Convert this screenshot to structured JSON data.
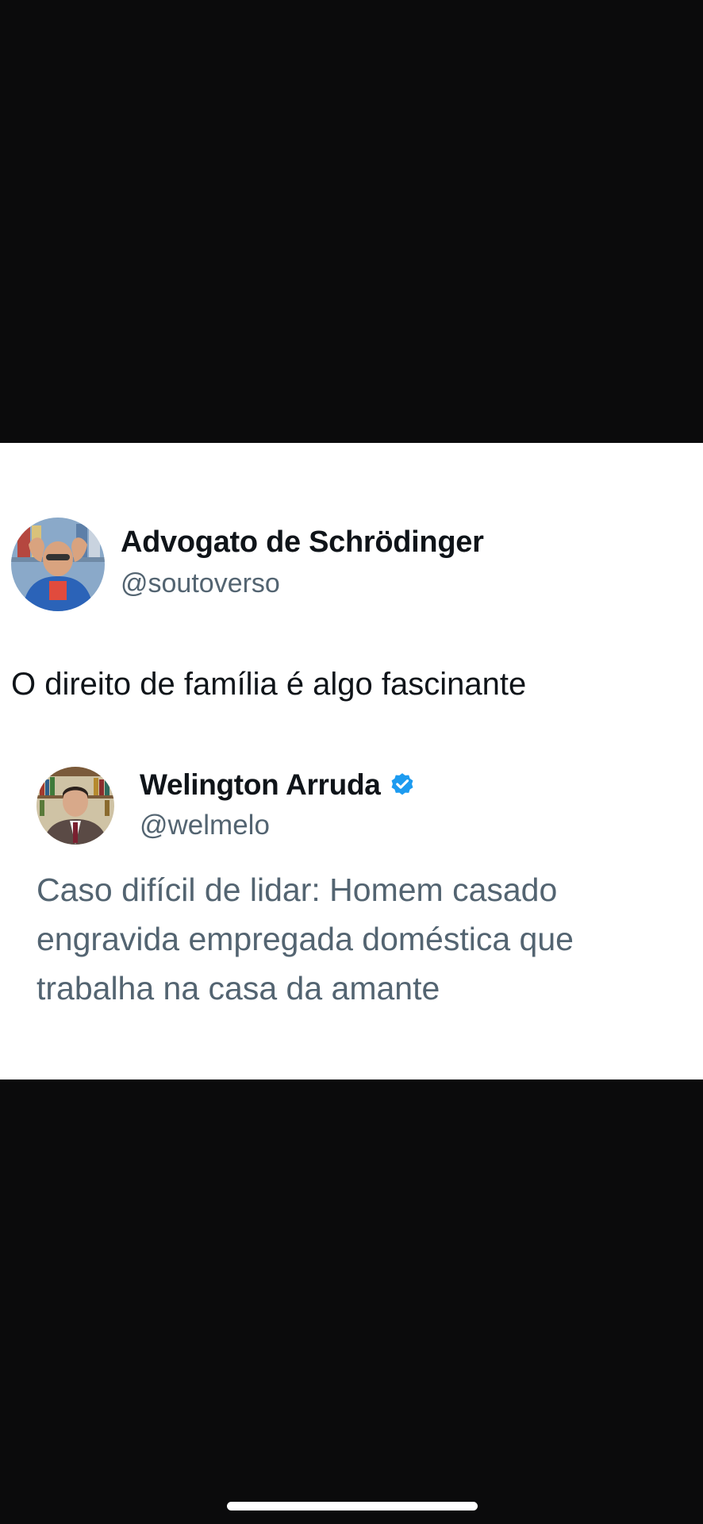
{
  "post": {
    "author": {
      "name": "Advogato de Schrödinger",
      "handle": "@soutoverso",
      "avatar_icon": "avatar-person-icon"
    },
    "text": "O direito de família é algo fascinante",
    "quoted_post": {
      "author": {
        "name": "Welington Arruda",
        "handle": "@welmelo",
        "verified": true,
        "verified_icon": "verified-badge-icon",
        "avatar_icon": "avatar-person-icon"
      },
      "text_lines": [
        "Caso difícil de lidar: Homem casado",
        "engravida empregada doméstica que",
        "trabalha na casa da amante"
      ]
    }
  },
  "colors": {
    "background": "#0b0b0c",
    "card": "#ffffff",
    "primary_text": "#0f1419",
    "secondary_text": "#536471",
    "verified_blue": "#1d9bf0"
  }
}
